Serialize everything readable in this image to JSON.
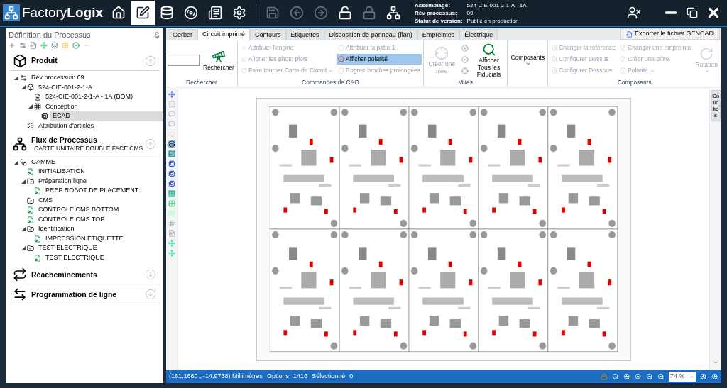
{
  "header": {
    "brand_light": "Factory",
    "brand_bold": "Logix",
    "info": [
      {
        "label": "Assemblage:",
        "value": "524-CIE-001-2-1-A - 1A"
      },
      {
        "label": "Rév processus:",
        "value": "09"
      },
      {
        "label": "Statut de version:",
        "value": "Publié en production"
      }
    ]
  },
  "left_panel": {
    "title": "Définition du Processus",
    "sections": [
      {
        "kind": "product",
        "title": "Produit",
        "expanded": true,
        "tree": [
          {
            "kind": "gear",
            "label": "Rév processus: 09",
            "expanded": true,
            "selected": false,
            "children": [
              {
                "kind": "product",
                "label": "524-CIE-001-2-1-A",
                "expanded": true,
                "selected": false,
                "children": [
                  {
                    "kind": "bom",
                    "label": "524-CIE-001-2-1-A - 1A (BOM)",
                    "selected": false
                  },
                  {
                    "kind": "design",
                    "label": "Conception",
                    "expanded": true,
                    "selected": false,
                    "children": [
                      {
                        "kind": "ecad",
                        "label": "ECAD",
                        "selected": true
                      }
                    ]
                  }
                ]
              },
              {
                "kind": "articles",
                "label": "Attribution d'articles",
                "selected": false
              }
            ]
          }
        ]
      },
      {
        "kind": "flow",
        "title": "Flux de Processus",
        "subtitle": "CARTE UNITAIRE DOUBLE FACE CMS",
        "expanded": true,
        "tree": [
          {
            "kind": "gamme",
            "label": "GAMME",
            "expanded": true,
            "selected": false,
            "children": [
              {
                "kind": "operation",
                "label": "INITIALISATION",
                "selected": false
              },
              {
                "kind": "folder",
                "label": "Préparation ligne",
                "expanded": true,
                "selected": false,
                "children": [
                  {
                    "kind": "operation",
                    "label": "PREP ROBOT DE PLACEMENT",
                    "selected": false
                  }
                ]
              },
              {
                "kind": "folder",
                "label": "CMS",
                "selected": false
              },
              {
                "kind": "operation",
                "label": "CONTROLE CMS BOTTOM",
                "selected": false
              },
              {
                "kind": "operation",
                "label": "CONTROLE CMS TOP",
                "selected": false
              },
              {
                "kind": "folder",
                "label": "Identification",
                "expanded": true,
                "selected": false,
                "children": [
                  {
                    "kind": "operation",
                    "label": "IMPRESSION ETIQUETTE",
                    "selected": false
                  }
                ]
              },
              {
                "kind": "folder",
                "label": "TEST ELECTRIQUE",
                "expanded": true,
                "selected": false,
                "children": [
                  {
                    "kind": "operation",
                    "label": "TEST ELECTRIQUE",
                    "selected": false
                  }
                ]
              }
            ]
          }
        ]
      },
      {
        "kind": "reroute",
        "title": "Réacheminements",
        "expanded": false
      },
      {
        "kind": "line",
        "title": "Programmation de ligne",
        "expanded": false
      }
    ]
  },
  "tabs": [
    {
      "label": "Gerber",
      "selected": false
    },
    {
      "label": "Circuit imprimé",
      "selected": true
    },
    {
      "label": "Contours",
      "selected": false
    },
    {
      "label": "Étiquettes",
      "selected": false
    },
    {
      "label": "Disposition de panneau (flan)",
      "selected": false
    },
    {
      "label": "Empreintes",
      "selected": false
    },
    {
      "label": "Électrique",
      "selected": false
    }
  ],
  "export_button": "Exporter le fichier GENCAD",
  "ribbon": [
    {
      "title": "Rechercher",
      "items": [
        {
          "kind": "field"
        },
        {
          "kind": "large",
          "label": "Rechercher",
          "disabled": false
        }
      ]
    },
    {
      "title": "Commandes de CAO",
      "items": [
        {
          "kind": "small",
          "label": "Attribuer l'origine",
          "disabled": true,
          "selected": false
        },
        {
          "kind": "small",
          "label": "Aligner les  photo plots",
          "disabled": true,
          "selected": false
        },
        {
          "kind": "small",
          "label": "Faire tourner Carte de Circuit",
          "disabled": true,
          "selected": false,
          "dropdown": true
        },
        {
          "kind": "small",
          "label": "Attribuer la patte 1",
          "disabled": true,
          "selected": false
        },
        {
          "kind": "small",
          "label": "Afficher polarité",
          "disabled": false,
          "selected": true
        },
        {
          "kind": "small",
          "label": "Rogner broches prolongées",
          "disabled": true,
          "selected": false
        }
      ]
    },
    {
      "title": "Mires",
      "items": [
        {
          "kind": "large",
          "label": "Créer une mire",
          "disabled": true
        },
        {
          "kind": "icon",
          "disabled": true
        },
        {
          "kind": "icon",
          "disabled": true
        },
        {
          "kind": "icon",
          "disabled": true
        },
        {
          "kind": "large",
          "label": "Afficher Tous les Fiducials",
          "disabled": false
        }
      ]
    },
    {
      "items": [
        {
          "kind": "large",
          "label": "Composants",
          "disabled": false,
          "dropdown": true
        }
      ]
    },
    {
      "title": "Composants",
      "items": [
        {
          "kind": "small",
          "label": "Changer la référence",
          "disabled": true,
          "selected": false
        },
        {
          "kind": "small",
          "label": "Configurer Dessus",
          "disabled": true,
          "selected": false
        },
        {
          "kind": "small",
          "label": "Configurer Dessous",
          "disabled": true,
          "selected": false
        },
        {
          "kind": "small",
          "label": "Changer une empreinte",
          "disabled": true,
          "selected": false
        },
        {
          "kind": "small",
          "label": "Créer une prise",
          "disabled": true,
          "selected": false
        },
        {
          "kind": "small",
          "label": "Polarité",
          "disabled": true,
          "selected": false,
          "dropdown": true
        },
        {
          "kind": "large",
          "label": "Rotation",
          "disabled": true,
          "dropdown": true
        }
      ]
    }
  ],
  "side_tab": "Couches",
  "status_bar": {
    "coordinates": "(161,1660 , -14,9738) Millimètres",
    "options_label": "Options",
    "options_value": "1416",
    "selected_label": "Sélectionné",
    "selected_value": "0",
    "zoom": "74 %"
  }
}
